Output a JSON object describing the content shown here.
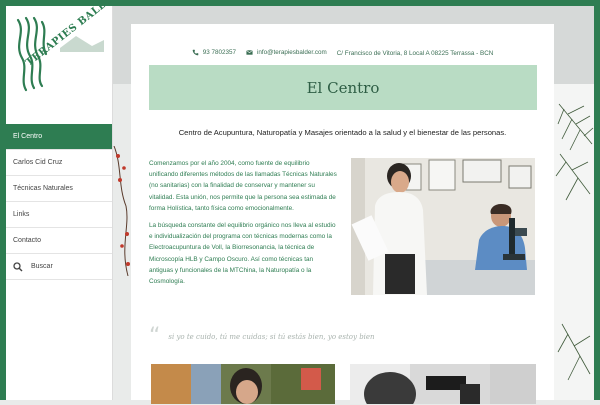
{
  "brand": {
    "logo_text": "TERAPIES BALDER"
  },
  "sidebar": {
    "items": [
      {
        "label": "El Centro",
        "active": true
      },
      {
        "label": "Carlos Cid Cruz",
        "active": false
      },
      {
        "label": "Técnicas Naturales",
        "active": false
      },
      {
        "label": "Links",
        "active": false
      },
      {
        "label": "Contacto",
        "active": false
      }
    ],
    "search_label": "Buscar"
  },
  "contact": {
    "phone": "93 7802357",
    "email": "info@terapiesbalder.com",
    "address": "C/ Francisco de Vitoria, 8 Local A 08225 Terrassa - BCN"
  },
  "page": {
    "title": "El Centro",
    "intro": "Centro de Acupuntura, Naturopatía y Masajes orientado a la salud y el bienestar de las personas.",
    "paragraphs": [
      "Comenzamos por el año 2004, como fuente de equilibrio unificando diferentes métodos de las llamadas Técnicas Naturales (no sanitarias) con la finalidad de conservar y mantener su vitalidad. Esta unión, nos permite que la persona sea estimada de forma Holística, tanto física como emocionalmente.",
      "La búsqueda constante del equilibrio orgánico nos lleva al estudio e individualización del programa con técnicas modernas como la Electroacupuntura de Voll, la Biorresonancia, la técnica de Microscopía HLB y Campo Oscuro. Así como técnicas tan antiguas y funcionales de la MTChina, la Naturopatía o la Cosmología."
    ],
    "quote": "si yo te cuido, tú me cuidas; si tú estás bien, yo estoy bien"
  },
  "colors": {
    "brand_green": "#2e7d52",
    "hero_green": "#b9dcc4",
    "text_green": "#2e7d52"
  },
  "icons": [
    "phone-icon",
    "email-icon",
    "search-icon",
    "quote-icon"
  ]
}
